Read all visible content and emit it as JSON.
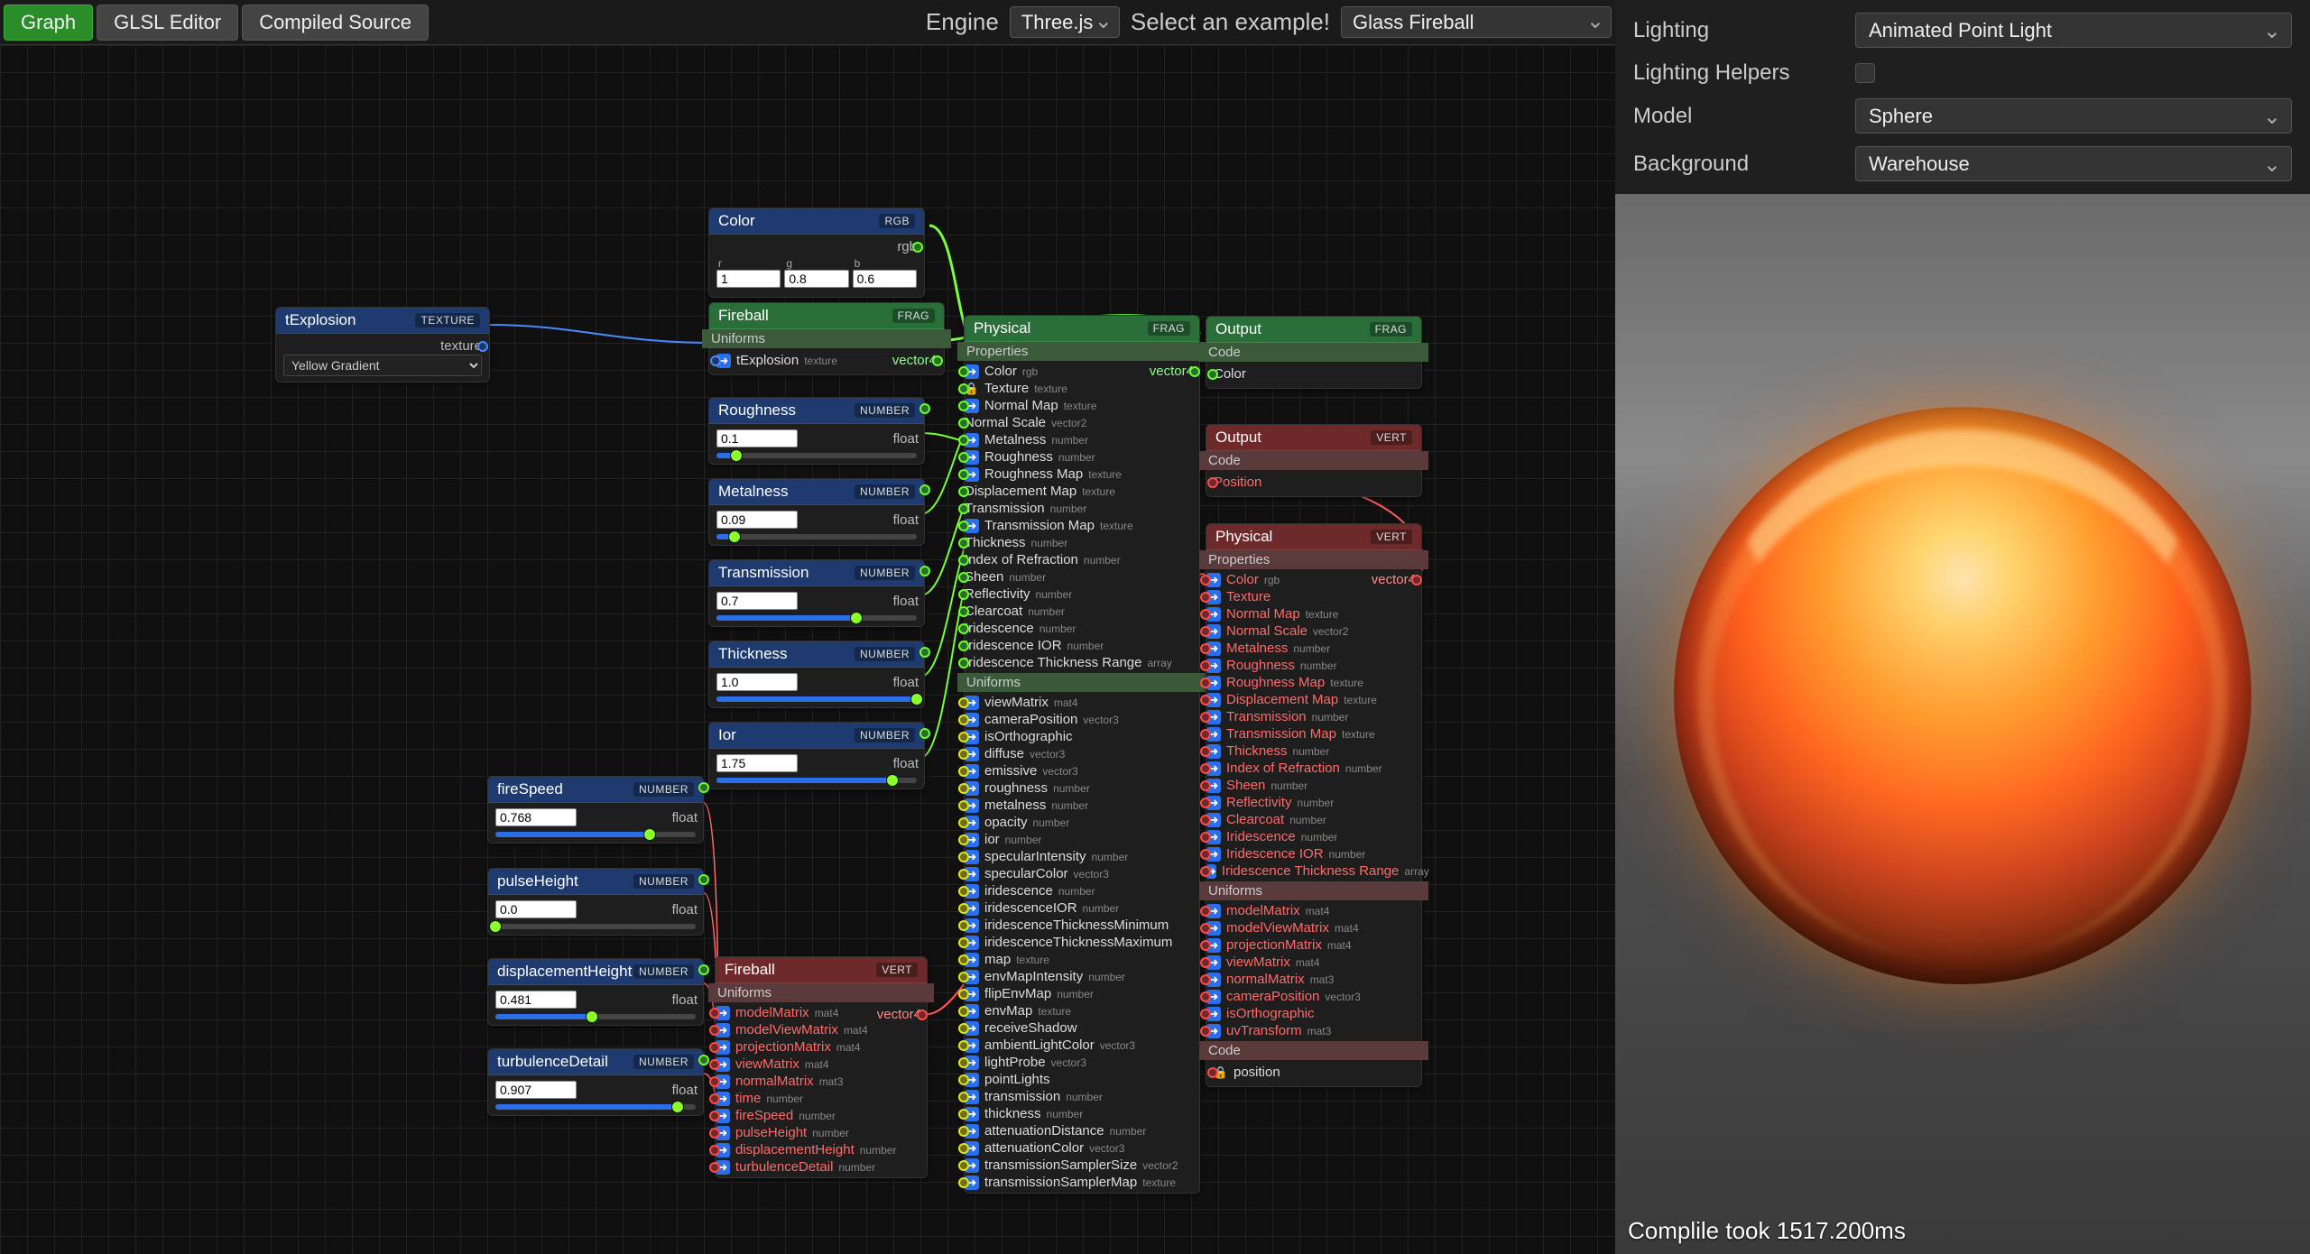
{
  "toolbar": {
    "tabs": {
      "graph": "Graph",
      "editor": "GLSL Editor",
      "compiled": "Compiled Source"
    },
    "engine_label": "Engine",
    "engine_value": "Three.js",
    "example_label": "Select an example!",
    "example_value": "Glass Fireball"
  },
  "rightPanel": {
    "lighting_label": "Lighting",
    "lighting_value": "Animated Point Light",
    "helpers_label": "Lighting Helpers",
    "helpers_checked": false,
    "model_label": "Model",
    "model_value": "Sphere",
    "background_label": "Background",
    "background_value": "Warehouse",
    "status": "Complile took 1517.200ms"
  },
  "nodes": {
    "texplosion": {
      "title": "tExplosion",
      "tag": "TEXTURE",
      "dropdown": "Yellow Gradient",
      "out_label": "texture"
    },
    "color": {
      "title": "Color",
      "tag": "RGB",
      "channels": {
        "r": "1",
        "g": "0.8",
        "b": "0.6"
      },
      "out_label": "rgb"
    },
    "fireballFrag": {
      "title": "Fireball",
      "tag": "FRAG",
      "section": "Uniforms",
      "uniforms": [
        {
          "name": "tExplosion",
          "type": "texture"
        }
      ],
      "out_type": "vector4"
    },
    "roughness": {
      "title": "Roughness",
      "tag": "NUMBER",
      "value": "0.1",
      "slider_pct": 10,
      "out_label": "float"
    },
    "metalness": {
      "title": "Metalness",
      "tag": "NUMBER",
      "value": "0.09",
      "slider_pct": 9,
      "out_label": "float"
    },
    "transmission": {
      "title": "Transmission",
      "tag": "NUMBER",
      "value": "0.7",
      "slider_pct": 70,
      "out_label": "float"
    },
    "thickness": {
      "title": "Thickness",
      "tag": "NUMBER",
      "value": "1.0",
      "slider_pct": 100,
      "out_label": "float"
    },
    "ior": {
      "title": "Ior",
      "tag": "NUMBER",
      "value": "1.75",
      "slider_pct": 88,
      "out_label": "float"
    },
    "fireSpeed": {
      "title": "fireSpeed",
      "tag": "NUMBER",
      "value": "0.768",
      "slider_pct": 77,
      "out_label": "float"
    },
    "pulseHeight": {
      "title": "pulseHeight",
      "tag": "NUMBER",
      "value": "0.0",
      "slider_pct": 0,
      "out_label": "float"
    },
    "displacementHeight": {
      "title": "displacementHeight",
      "tag": "NUMBER",
      "value": "0.481",
      "slider_pct": 48,
      "out_label": "float"
    },
    "turbulenceDetail": {
      "title": "turbulenceDetail",
      "tag": "NUMBER",
      "value": "0.907",
      "slider_pct": 91,
      "out_label": "float"
    },
    "fireballVert": {
      "title": "Fireball",
      "tag": "VERT",
      "section": "Uniforms",
      "rows": [
        {
          "name": "modelMatrix",
          "type": "mat4"
        },
        {
          "name": "modelViewMatrix",
          "type": "mat4"
        },
        {
          "name": "projectionMatrix",
          "type": "mat4"
        },
        {
          "name": "viewMatrix",
          "type": "mat4"
        },
        {
          "name": "normalMatrix",
          "type": "mat3"
        },
        {
          "name": "time",
          "type": "number"
        },
        {
          "name": "fireSpeed",
          "type": "number"
        },
        {
          "name": "pulseHeight",
          "type": "number"
        },
        {
          "name": "displacementHeight",
          "type": "number"
        },
        {
          "name": "turbulenceDetail",
          "type": "number"
        }
      ],
      "out_type": "vector4"
    },
    "physicalFrag": {
      "title": "Physical",
      "tag": "FRAG",
      "props_label": "Properties",
      "props": [
        {
          "name": "Color",
          "type": "rgb",
          "icon": "arrow-in"
        },
        {
          "name": "Texture",
          "type": "texture",
          "icon": "lock"
        },
        {
          "name": "Normal Map",
          "type": "texture",
          "icon": "arrow-in"
        },
        {
          "name": "Normal Scale",
          "type": "vector2"
        },
        {
          "name": "Metalness",
          "type": "number",
          "icon": "arrow-in"
        },
        {
          "name": "Roughness",
          "type": "number",
          "icon": "arrow-in"
        },
        {
          "name": "Roughness Map",
          "type": "texture",
          "icon": "arrow-in"
        },
        {
          "name": "Displacement Map",
          "type": "texture"
        },
        {
          "name": "Transmission",
          "type": "number"
        },
        {
          "name": "Transmission Map",
          "type": "texture",
          "icon": "arrow-in"
        },
        {
          "name": "Thickness",
          "type": "number"
        },
        {
          "name": "Index of Refraction",
          "type": "number"
        },
        {
          "name": "Sheen",
          "type": "number"
        },
        {
          "name": "Reflectivity",
          "type": "number"
        },
        {
          "name": "Clearcoat",
          "type": "number"
        },
        {
          "name": "Iridescence",
          "type": "number"
        },
        {
          "name": "Iridescence IOR",
          "type": "number"
        },
        {
          "name": "Iridescence Thickness Range",
          "type": "array"
        }
      ],
      "uniforms_label": "Uniforms",
      "uniforms": [
        {
          "name": "viewMatrix",
          "type": "mat4"
        },
        {
          "name": "cameraPosition",
          "type": "vector3"
        },
        {
          "name": "isOrthographic",
          "type": ""
        },
        {
          "name": "diffuse",
          "type": "vector3"
        },
        {
          "name": "emissive",
          "type": "vector3"
        },
        {
          "name": "roughness",
          "type": "number"
        },
        {
          "name": "metalness",
          "type": "number"
        },
        {
          "name": "opacity",
          "type": "number"
        },
        {
          "name": "ior",
          "type": "number"
        },
        {
          "name": "specularIntensity",
          "type": "number"
        },
        {
          "name": "specularColor",
          "type": "vector3"
        },
        {
          "name": "iridescence",
          "type": "number"
        },
        {
          "name": "iridescenceIOR",
          "type": "number"
        },
        {
          "name": "iridescenceThicknessMinimum",
          "type": ""
        },
        {
          "name": "iridescenceThicknessMaximum",
          "type": ""
        },
        {
          "name": "map",
          "type": "texture"
        },
        {
          "name": "envMapIntensity",
          "type": "number"
        },
        {
          "name": "flipEnvMap",
          "type": "number"
        },
        {
          "name": "envMap",
          "type": "texture"
        },
        {
          "name": "receiveShadow",
          "type": ""
        },
        {
          "name": "ambientLightColor",
          "type": "vector3"
        },
        {
          "name": "lightProbe",
          "type": "vector3"
        },
        {
          "name": "pointLights",
          "type": ""
        },
        {
          "name": "transmission",
          "type": "number"
        },
        {
          "name": "thickness",
          "type": "number"
        },
        {
          "name": "attenuationDistance",
          "type": "number"
        },
        {
          "name": "attenuationColor",
          "type": "vector3"
        },
        {
          "name": "transmissionSamplerSize",
          "type": "vector2"
        },
        {
          "name": "transmissionSamplerMap",
          "type": "texture"
        }
      ],
      "out_type": "vector4"
    },
    "outputFrag": {
      "title": "Output",
      "tag": "FRAG",
      "code_label": "Code",
      "rows": [
        {
          "name": "Color",
          "type": ""
        }
      ]
    },
    "outputVert": {
      "title": "Output",
      "tag": "VERT",
      "code_label": "Code",
      "rows": [
        {
          "name": "Position",
          "type": ""
        }
      ]
    },
    "physicalVert": {
      "title": "Physical",
      "tag": "VERT",
      "props_label": "Properties",
      "out_type": "vector4",
      "props": [
        {
          "name": "Color",
          "type": "rgb"
        },
        {
          "name": "Texture",
          "type": ""
        },
        {
          "name": "Normal Map",
          "type": "texture"
        },
        {
          "name": "Normal Scale",
          "type": "vector2"
        },
        {
          "name": "Metalness",
          "type": "number"
        },
        {
          "name": "Roughness",
          "type": "number"
        },
        {
          "name": "Roughness Map",
          "type": "texture"
        },
        {
          "name": "Displacement Map",
          "type": "texture"
        },
        {
          "name": "Transmission",
          "type": "number"
        },
        {
          "name": "Transmission Map",
          "type": "texture"
        },
        {
          "name": "Thickness",
          "type": "number"
        },
        {
          "name": "Index of Refraction",
          "type": "number"
        },
        {
          "name": "Sheen",
          "type": "number"
        },
        {
          "name": "Reflectivity",
          "type": "number"
        },
        {
          "name": "Clearcoat",
          "type": "number"
        },
        {
          "name": "Iridescence",
          "type": "number"
        },
        {
          "name": "Iridescence IOR",
          "type": "number"
        },
        {
          "name": "Iridescence Thickness Range",
          "type": "array"
        }
      ],
      "uniforms_label": "Uniforms",
      "uniforms": [
        {
          "name": "modelMatrix",
          "type": "mat4"
        },
        {
          "name": "modelViewMatrix",
          "type": "mat4"
        },
        {
          "name": "projectionMatrix",
          "type": "mat4"
        },
        {
          "name": "viewMatrix",
          "type": "mat4"
        },
        {
          "name": "normalMatrix",
          "type": "mat3"
        },
        {
          "name": "cameraPosition",
          "type": "vector3"
        },
        {
          "name": "isOrthographic",
          "type": ""
        },
        {
          "name": "uvTransform",
          "type": "mat3"
        }
      ],
      "code_label": "Code",
      "code_rows": [
        {
          "name": "position",
          "icon": "lock"
        }
      ]
    }
  }
}
